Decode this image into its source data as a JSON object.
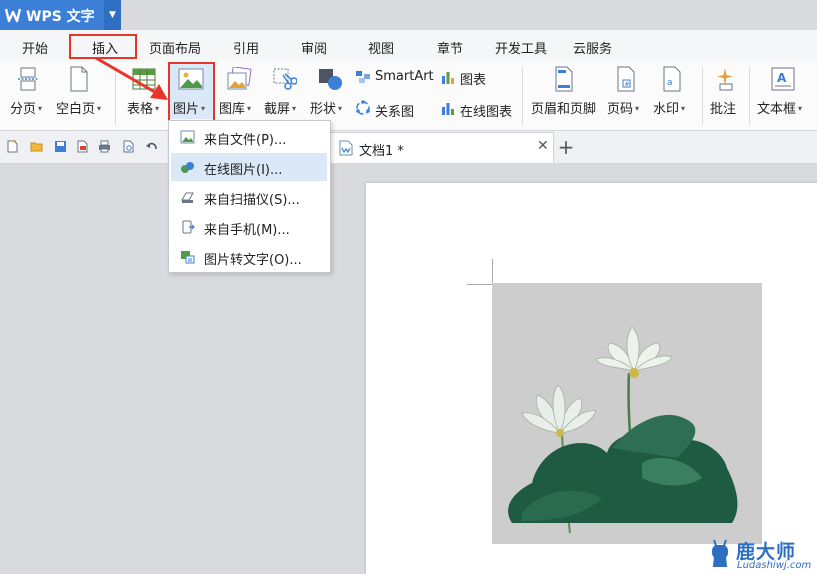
{
  "app": {
    "title": "WPS 文字"
  },
  "tabs": [
    "开始",
    "插入",
    "页面布局",
    "引用",
    "审阅",
    "视图",
    "章节",
    "开发工具",
    "云服务"
  ],
  "ribbon": {
    "split_page": "分页",
    "blank_page": "空白页",
    "table": "表格",
    "picture": "图片",
    "gallery": "图库",
    "screenshot": "截屏",
    "shapes": "形状",
    "smartart": "SmartArt",
    "chart": "图表",
    "relation": "关系图",
    "online_chart": "在线图表",
    "header_footer": "页眉和页脚",
    "page_number": "页码",
    "watermark": "水印",
    "comment": "批注",
    "textbox": "文本框"
  },
  "picture_menu": {
    "items": [
      "来自文件(P)...",
      "在线图片(I)...",
      "来自扫描仪(S)...",
      "来自手机(M)...",
      "图片转文字(O)..."
    ]
  },
  "doc_tab": {
    "title": "文档1 *"
  },
  "watermark": {
    "brand": "鹿大师",
    "url": "Ludashiwj.com"
  },
  "colors": {
    "accent": "#3c7fd6",
    "highlight": "#e8352a",
    "menu_hover": "#dbe8f7"
  }
}
